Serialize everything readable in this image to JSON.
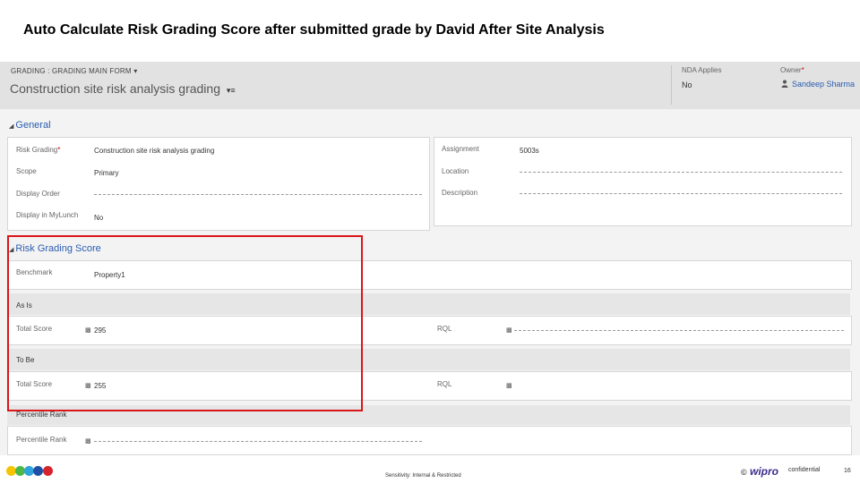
{
  "slide": {
    "title": "Auto Calculate Risk Grading Score after submitted grade by David After Site Analysis"
  },
  "header": {
    "breadcrumb": "GRADING : GRADING MAIN FORM",
    "breadcrumb_caret": "▾",
    "record_title": "Construction site risk analysis grading",
    "record_menu": "▾≡",
    "fields": [
      {
        "label": "NDA Applies",
        "value": "No"
      },
      {
        "label": "Owner",
        "value": "Sandeep Sharma",
        "required_mark": "*"
      }
    ]
  },
  "general": {
    "heading": "General",
    "left_fields": [
      {
        "label": "Risk Grading",
        "value": "Construction site risk analysis grading",
        "required_mark": "*"
      },
      {
        "label": "Scope",
        "value": "Primary"
      },
      {
        "label": "Display Order",
        "value": ""
      },
      {
        "label": "Display in MyLunch",
        "value": "No"
      }
    ],
    "right_fields": [
      {
        "label": "Assignment",
        "value": "5003s"
      },
      {
        "label": "Location",
        "value": ""
      },
      {
        "label": "Description",
        "value": ""
      }
    ]
  },
  "risk_score": {
    "heading": "Risk Grading Score",
    "benchmark": {
      "label": "Benchmark",
      "value": "Property1"
    },
    "as_is": {
      "heading": "As Is",
      "total_label": "Total Score",
      "total_value": "295",
      "rql_label": "RQL",
      "rql_value": ""
    },
    "to_be": {
      "heading": "To Be",
      "total_label": "Total Score",
      "total_value": "255",
      "rql_label": "RQL",
      "rql_value": ""
    },
    "percentile": {
      "heading": "Percentile Rank",
      "label": "Percentile Rank",
      "value": ""
    }
  },
  "footer": {
    "classification": "Sensitivity: Internal & Restricted",
    "logo": "wipro",
    "confidential": "confidential",
    "page": "16",
    "dot_colors": [
      "#f5c400",
      "#4db848",
      "#2fa4dc",
      "#1f4fa3",
      "#d6232c"
    ]
  },
  "icons": {
    "lock": "lock-icon",
    "user": "user-icon",
    "collapse": "collapse-arrow-icon"
  },
  "colors": {
    "highlight": "#d9161a",
    "link": "#2a5db0",
    "header_band": "#e2e2e2"
  }
}
